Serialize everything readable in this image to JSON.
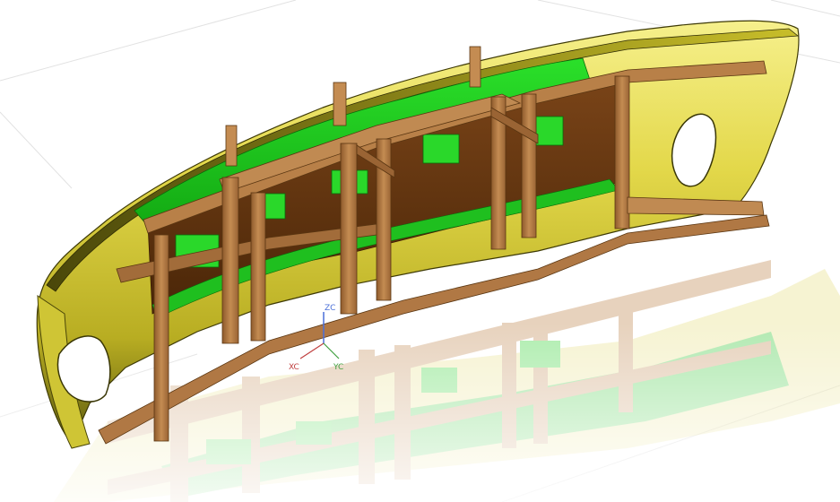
{
  "viewport": {
    "background": "#ffffff",
    "floor_grid_color": "#dcdcdc",
    "reflection_opacity": 0.35
  },
  "model": {
    "bumper_color": "#d8cf3a",
    "bumper_highlight": "#f4ee8a",
    "bumper_shadow": "#6d6a10",
    "inner_panel_color": "#22d21e",
    "frame_color": "#b07a44",
    "frame_dark": "#7a4e24",
    "frame_light": "#d19a62",
    "interior_brown": "#6b3a12"
  },
  "triad": {
    "z_label": "ZC",
    "x_label": "XC",
    "y_label": "YC",
    "z_color": "#4a6fd8",
    "x_color": "#c04040",
    "y_color": "#40a040"
  }
}
